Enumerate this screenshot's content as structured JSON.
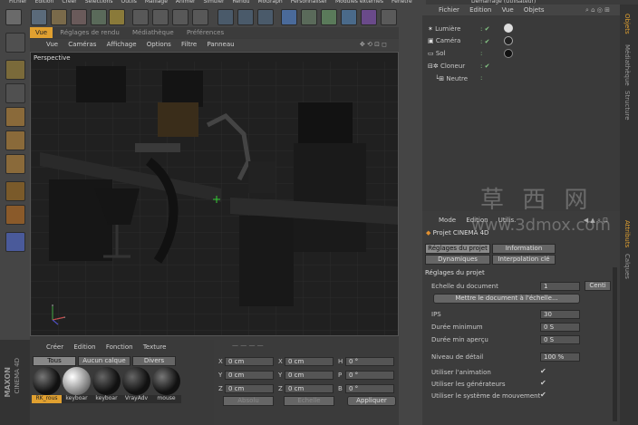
{
  "top_menu": [
    "Fichier",
    "Edition",
    "Créer",
    "Sélections",
    "Outils",
    "Maillage",
    "Animer",
    "Simuler",
    "Rendu",
    "MoGraph",
    "Personnaliser",
    "Modules externes",
    "Fenêtre"
  ],
  "top_right_title": "Démarrage (Utilisateur)",
  "viewport": {
    "tabs": [
      "Vue",
      "Réglages de rendu",
      "Médiathèque",
      "Préférences"
    ],
    "menu": [
      "Vue",
      "Caméras",
      "Affichage",
      "Options",
      "Filtre",
      "Panneau"
    ],
    "label": "Perspective"
  },
  "objects": {
    "menu": [
      "Fichier",
      "Edition",
      "Vue",
      "Objets"
    ],
    "items": [
      "Lumière",
      "Caméra",
      "Sol",
      "Cloneur",
      "Neutre"
    ]
  },
  "right_vertical_tabs": [
    "Objets",
    "Médiathèque",
    "Structure"
  ],
  "attr_vertical_tabs": [
    "Attributs",
    "Calques"
  ],
  "attributes": {
    "menu": [
      "Mode",
      "Edition",
      "Utilis."
    ],
    "project_title": "Projet CINEMA 4D",
    "tabs_row1": [
      "Réglages du projet",
      "Information"
    ],
    "tabs_row2": [
      "Dynamiques",
      "Interpolation clé"
    ],
    "section": "Réglages du projet",
    "rows": [
      {
        "label": "Echelle du document",
        "value": "1",
        "extra": "Centi"
      },
      {
        "label": "IPS",
        "value": "30"
      },
      {
        "label": "Durée minimum",
        "value": "0 S"
      },
      {
        "label": "Durée min aperçu",
        "value": "0 S"
      },
      {
        "label": "Niveau de détail",
        "value": "100 %"
      }
    ],
    "scale_button": "Mettre le document à l'échelle...",
    "checks": [
      "Utiliser l'animation",
      "Utiliser les générateurs",
      "Utiliser le système de mouvement"
    ]
  },
  "materials": {
    "menu": [
      "Créer",
      "Edition",
      "Fonction",
      "Texture"
    ],
    "tabs": [
      "Tous",
      "Aucun calque",
      "Divers"
    ],
    "items": [
      "RK_rous",
      "keyboar",
      "keyboar",
      "VrayAdv",
      "mouse"
    ]
  },
  "coords": {
    "axes1": [
      "X",
      "Y",
      "Z"
    ],
    "axes2": [
      "X",
      "Y",
      "Z"
    ],
    "axes3": [
      "H",
      "P",
      "B"
    ],
    "value": "0 cm",
    "angle": "0 °",
    "dropdown1": "Absolu",
    "dropdown2": "Echelle",
    "apply": "Appliquer"
  },
  "brand": {
    "line1": "MAXON",
    "line2": "CINEMA 4D"
  },
  "watermark": {
    "cn": "草 西 网",
    "url": "www.3dmox.com"
  }
}
